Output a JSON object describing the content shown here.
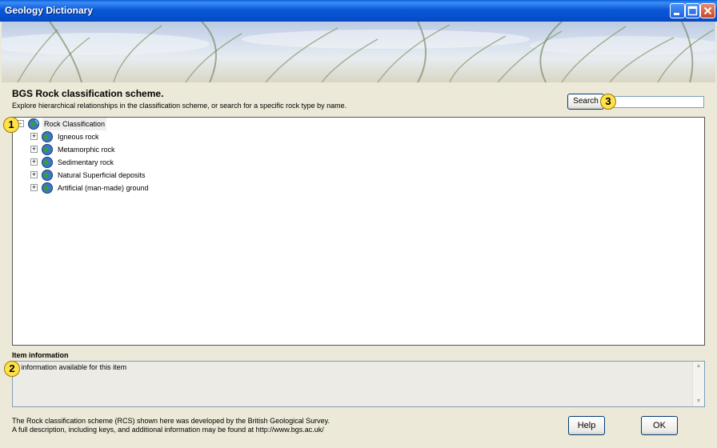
{
  "window": {
    "title": "Geology Dictionary"
  },
  "header": {
    "heading": "BGS Rock classification scheme.",
    "subheading": "Explore hierarchical relationships in the classification scheme, or search for a specific rock type by name."
  },
  "search": {
    "button_label": "Search",
    "value": "",
    "placeholder": ""
  },
  "tree": {
    "root": {
      "label": "Rock Classification",
      "expander": "-"
    },
    "children": [
      {
        "label": "Igneous rock",
        "expander": "+"
      },
      {
        "label": "Metamorphic rock",
        "expander": "+"
      },
      {
        "label": "Sedimentary rock",
        "expander": "+"
      },
      {
        "label": "Natural Superficial deposits",
        "expander": "+"
      },
      {
        "label": "Artificial (man-made) ground",
        "expander": "+"
      }
    ]
  },
  "item_info": {
    "label": "Item information",
    "text": "o information available for this item"
  },
  "footer": {
    "line1": "The Rock classification scheme (RCS) shown here was developed by the British Geological Survey.",
    "line2": "A full description, including keys, and additional information may be found at http://www.bgs.ac.uk/"
  },
  "buttons": {
    "help": "Help",
    "ok": "OK"
  },
  "callouts": [
    "1",
    "2",
    "3"
  ],
  "icons": {
    "tree_node": "globe-icon",
    "minimize": "minimize-icon",
    "maximize": "maximize-icon",
    "close": "close-icon"
  },
  "colors": {
    "titlebar": "#0a58d6",
    "window_bg": "#ece9d8",
    "callout": "#ffe14a"
  }
}
